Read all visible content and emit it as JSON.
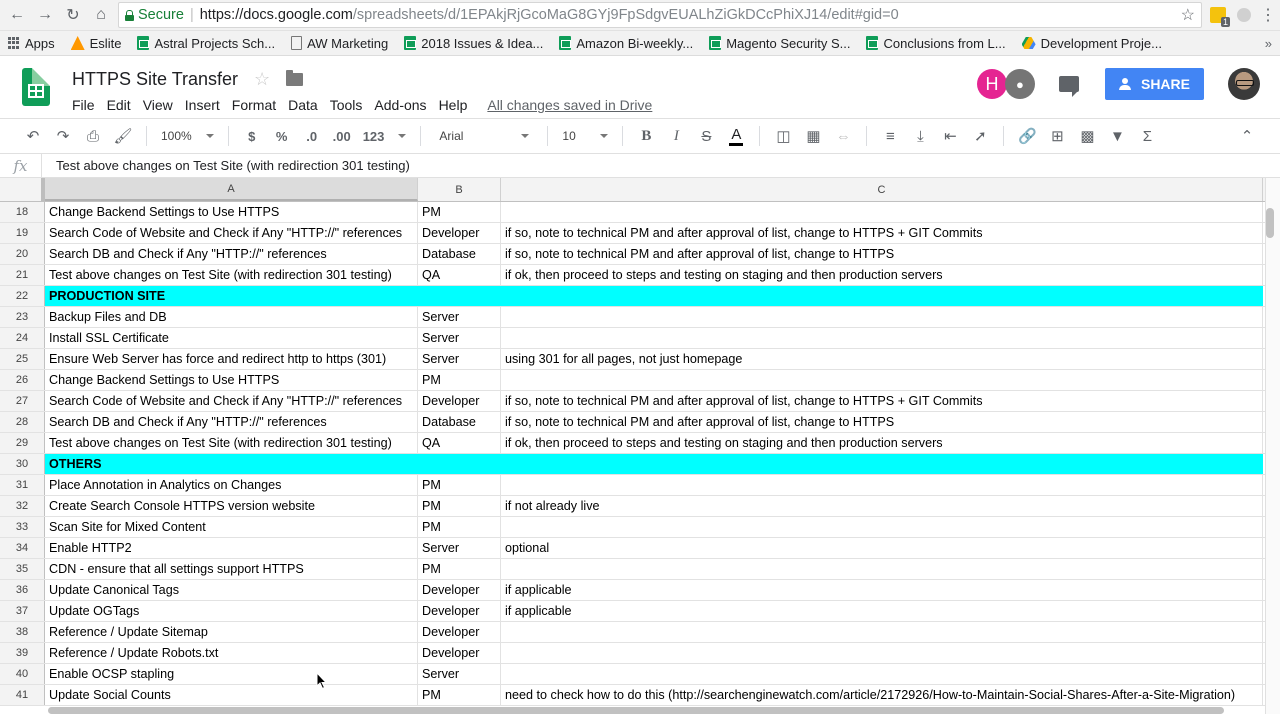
{
  "browser": {
    "secure_label": "Secure",
    "url_host": "https://docs.google.com",
    "url_path": "/spreadsheets/d/1EPAkjRjGcoMaG8GYj9FpSdgvEUALhZiGkDCcPhiXJ14/edit#gid=0",
    "ext_badge": "1"
  },
  "bookmarks": [
    {
      "label": "Apps",
      "icon": "apps-grid-icon"
    },
    {
      "label": "Eslite",
      "icon": "eslite-icon"
    },
    {
      "label": "Astral Projects Sch...",
      "icon": "sheets-icon"
    },
    {
      "label": "AW Marketing",
      "icon": "page-icon"
    },
    {
      "label": "2018 Issues & Idea...",
      "icon": "sheets-icon"
    },
    {
      "label": "Amazon Bi-weekly...",
      "icon": "sheets-icon"
    },
    {
      "label": "Magento Security S...",
      "icon": "sheets-icon"
    },
    {
      "label": "Conclusions from L...",
      "icon": "sheets-icon"
    },
    {
      "label": "Development Proje...",
      "icon": "drive-icon"
    }
  ],
  "doc": {
    "title": "HTTPS Site Transfer",
    "saved_status": "All changes saved in Drive",
    "menu": [
      "File",
      "Edit",
      "View",
      "Insert",
      "Format",
      "Data",
      "Tools",
      "Add-ons",
      "Help"
    ],
    "avatar_letter": "H",
    "share_label": "SHARE"
  },
  "toolbar": {
    "zoom": "100%",
    "currency": "$",
    "percent": "%",
    "dec_less": ".0",
    "dec_more": ".00",
    "format_more": "123",
    "font": "Arial",
    "font_size": "10",
    "bold": "B",
    "italic": "I",
    "strike": "S",
    "text_color": "A",
    "sum": "Σ"
  },
  "formula_bar": {
    "fx": "fx",
    "content": "Test above changes on Test Site (with redirection 301 testing)"
  },
  "columns": [
    "A",
    "B",
    "C"
  ],
  "colors": {
    "section_bg": "#00ffff",
    "share_bg": "#4285f4",
    "sheets_green": "#0f9d58",
    "avatar_pink": "#e52592"
  },
  "rows": [
    {
      "n": "18",
      "a": "Change Backend Settings to Use HTTPS",
      "b": "PM",
      "c": ""
    },
    {
      "n": "19",
      "a": "Search Code of Website and Check if Any \"HTTP://\" references",
      "b": "Developer",
      "c": "if so, note to technical PM and after approval of list, change to HTTPS + GIT Commits"
    },
    {
      "n": "20",
      "a": "Search DB and Check if Any \"HTTP://\" references",
      "b": "Database",
      "c": "if so, note to technical PM and after approval of list, change to HTTPS"
    },
    {
      "n": "21",
      "a": "Test above changes on Test Site (with redirection 301 testing)",
      "b": "QA",
      "c": "if ok, then proceed to steps and testing on staging and then production servers"
    },
    {
      "n": "22",
      "section": "PRODUCTION SITE"
    },
    {
      "n": "23",
      "a": "Backup Files and DB",
      "b": "Server",
      "c": ""
    },
    {
      "n": "24",
      "a": "Install SSL Certificate",
      "b": "Server",
      "c": ""
    },
    {
      "n": "25",
      "a": "Ensure Web Server has force and redirect http to https (301)",
      "b": "Server",
      "c": "using 301 for all pages, not just homepage"
    },
    {
      "n": "26",
      "a": "Change Backend Settings to Use HTTPS",
      "b": "PM",
      "c": ""
    },
    {
      "n": "27",
      "a": "Search Code of Website and Check if Any \"HTTP://\" references",
      "b": "Developer",
      "c": "if so, note to technical PM and after approval of list, change to HTTPS + GIT Commits"
    },
    {
      "n": "28",
      "a": "Search DB and Check if Any \"HTTP://\" references",
      "b": "Database",
      "c": "if so, note to technical PM and after approval of list, change to HTTPS"
    },
    {
      "n": "29",
      "a": "Test above changes on Test Site (with redirection 301 testing)",
      "b": "QA",
      "c": "if ok, then proceed to steps and testing on staging and then production servers"
    },
    {
      "n": "30",
      "section": "OTHERS"
    },
    {
      "n": "31",
      "a": "Place Annotation in Analytics on Changes",
      "b": "PM",
      "c": ""
    },
    {
      "n": "32",
      "a": "Create Search Console HTTPS version website",
      "b": "PM",
      "c": "if not already live"
    },
    {
      "n": "33",
      "a": "Scan Site for Mixed Content",
      "b": "PM",
      "c": ""
    },
    {
      "n": "34",
      "a": "Enable HTTP2",
      "b": "Server",
      "c": "optional"
    },
    {
      "n": "35",
      "a": "CDN - ensure that all settings support HTTPS",
      "b": "PM",
      "c": ""
    },
    {
      "n": "36",
      "a": "Update Canonical Tags",
      "b": "Developer",
      "c": "if applicable"
    },
    {
      "n": "37",
      "a": "Update OGTags",
      "b": "Developer",
      "c": "if applicable"
    },
    {
      "n": "38",
      "a": "Reference / Update Sitemap",
      "b": "Developer",
      "c": ""
    },
    {
      "n": "39",
      "a": "Reference / Update Robots.txt",
      "b": "Developer",
      "c": ""
    },
    {
      "n": "40",
      "a": "Enable OCSP stapling",
      "b": "Server",
      "c": ""
    },
    {
      "n": "41",
      "a": "Update Social Counts",
      "b": "PM",
      "c": "need to check how to do this (http://searchenginewatch.com/article/2172926/How-to-Maintain-Social-Shares-After-a-Site-Migration)"
    }
  ]
}
